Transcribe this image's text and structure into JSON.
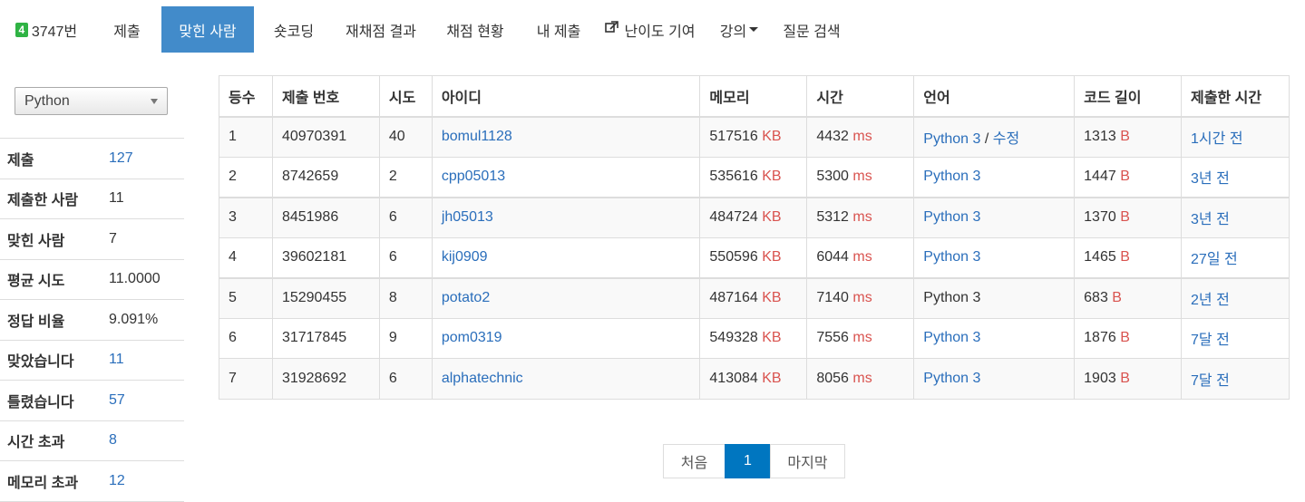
{
  "nav": {
    "problem_badge": "4",
    "problem_id": "3747번",
    "items": [
      {
        "label": "제출"
      },
      {
        "label": "맞힌 사람"
      },
      {
        "label": "숏코딩"
      },
      {
        "label": "재채점 결과"
      },
      {
        "label": "채점 현황"
      },
      {
        "label": "내 제출"
      },
      {
        "label": "난이도 기여"
      },
      {
        "label": "강의"
      },
      {
        "label": "질문 검색"
      }
    ],
    "active": "맞힌 사람"
  },
  "language_filter": {
    "selected": "Python"
  },
  "stats": [
    {
      "label": "제출",
      "value": "127"
    },
    {
      "label": "제출한 사람",
      "value": "11"
    },
    {
      "label": "맞힌 사람",
      "value": "7"
    },
    {
      "label": "평균 시도",
      "value": "11.0000"
    },
    {
      "label": "정답 비율",
      "value": "9.091%"
    },
    {
      "label": "맞았습니다",
      "value": "11"
    },
    {
      "label": "틀렸습니다",
      "value": "57"
    },
    {
      "label": "시간 초과",
      "value": "8"
    },
    {
      "label": "메모리 초과",
      "value": "12"
    }
  ],
  "table": {
    "headers": [
      "등수",
      "제출 번호",
      "시도",
      "아이디",
      "메모리",
      "시간",
      "언어",
      "코드 길이",
      "제출한 시간"
    ],
    "memory_unit": "KB",
    "time_unit": "ms",
    "length_unit": "B",
    "edit_label": "수정",
    "rows": [
      {
        "rank": "1",
        "submission": "40970391",
        "tries": "40",
        "user": "bomul1128",
        "memory": "517516",
        "time": "4432",
        "language": "Python 3",
        "length": "1313",
        "when": "1시간 전"
      },
      {
        "rank": "2",
        "submission": "8742659",
        "tries": "2",
        "user": "cpp05013",
        "memory": "535616",
        "time": "5300",
        "language": "Python 3",
        "length": "1447",
        "when": "3년 전"
      },
      {
        "rank": "3",
        "submission": "8451986",
        "tries": "6",
        "user": "jh05013",
        "memory": "484724",
        "time": "5312",
        "language": "Python 3",
        "length": "1370",
        "when": "3년 전"
      },
      {
        "rank": "4",
        "submission": "39602181",
        "tries": "6",
        "user": "kij0909",
        "memory": "550596",
        "time": "6044",
        "language": "Python 3",
        "length": "1465",
        "when": "27일 전"
      },
      {
        "rank": "5",
        "submission": "15290455",
        "tries": "8",
        "user": "potato2",
        "memory": "487164",
        "time": "7140",
        "language": "Python 3",
        "length": "683",
        "when": "2년 전"
      },
      {
        "rank": "6",
        "submission": "31717845",
        "tries": "9",
        "user": "pom0319",
        "memory": "549328",
        "time": "7556",
        "language": "Python 3",
        "length": "1876",
        "when": "7달 전"
      },
      {
        "rank": "7",
        "submission": "31928692",
        "tries": "6",
        "user": "alphatechnic",
        "memory": "413084",
        "time": "8056",
        "language": "Python 3",
        "length": "1903",
        "when": "7달 전"
      }
    ]
  },
  "pagination": {
    "first": "처음",
    "current": "1",
    "last": "마지막"
  },
  "colors": {
    "nav_active": "#428bca",
    "link": "#2a6ebb",
    "unit": "#d9534f",
    "badge": "#2fb344",
    "page_active": "#0076c0"
  }
}
